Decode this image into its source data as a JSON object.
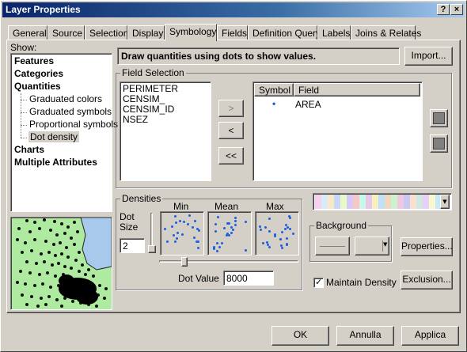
{
  "window": {
    "title": "Layer Properties",
    "help_label": "?",
    "close_label": "×"
  },
  "tabs": [
    {
      "label": "General"
    },
    {
      "label": "Source"
    },
    {
      "label": "Selection"
    },
    {
      "label": "Display"
    },
    {
      "label": "Symbology"
    },
    {
      "label": "Fields"
    },
    {
      "label": "Definition Query"
    },
    {
      "label": "Labels"
    },
    {
      "label": "Joins & Relates"
    }
  ],
  "active_tab": "Symbology",
  "show": {
    "label": "Show:",
    "items": [
      {
        "label": "Features"
      },
      {
        "label": "Categories"
      },
      {
        "label": "Quantities"
      },
      {
        "label": "Graduated colors"
      },
      {
        "label": "Graduated symbols"
      },
      {
        "label": "Proportional symbols"
      },
      {
        "label": "Dot density"
      },
      {
        "label": "Charts"
      },
      {
        "label": "Multiple Attributes"
      }
    ],
    "selected": "Dot density"
  },
  "header": {
    "description": "Draw quantities using dots to show values.",
    "import_label": "Import..."
  },
  "field_selection": {
    "label": "Field Selection",
    "available_fields": [
      "PERIMETER",
      "CENSIM_",
      "CENSIM_ID",
      "NSEZ"
    ],
    "add_label": ">",
    "remove_label": "<",
    "remove_all_label": "<<",
    "columns": {
      "symbol": "Symbol",
      "field": "Field"
    },
    "selected_fields": [
      {
        "symbol": "•",
        "field": "AREA"
      }
    ]
  },
  "densities": {
    "label": "Densities",
    "min_label": "Min",
    "mean_label": "Mean",
    "max_label": "Max",
    "dot_size_label": "Dot\nSize",
    "dot_size_value": "2",
    "dot_value_label": "Dot Value",
    "dot_value": "8000"
  },
  "background": {
    "label": "Background"
  },
  "buttons": {
    "properties": "Properties...",
    "exclusion": "Exclusion..."
  },
  "maintain_density": {
    "label": "Maintain Density",
    "checked": true
  },
  "footer": {
    "ok": "OK",
    "cancel": "Annulla",
    "apply": "Applica"
  },
  "colors": {
    "dot": "#1a5fe0",
    "titlebar": "#0a246a",
    "map_land": "#aeeaa0",
    "map_water": "#a8c8ec"
  }
}
